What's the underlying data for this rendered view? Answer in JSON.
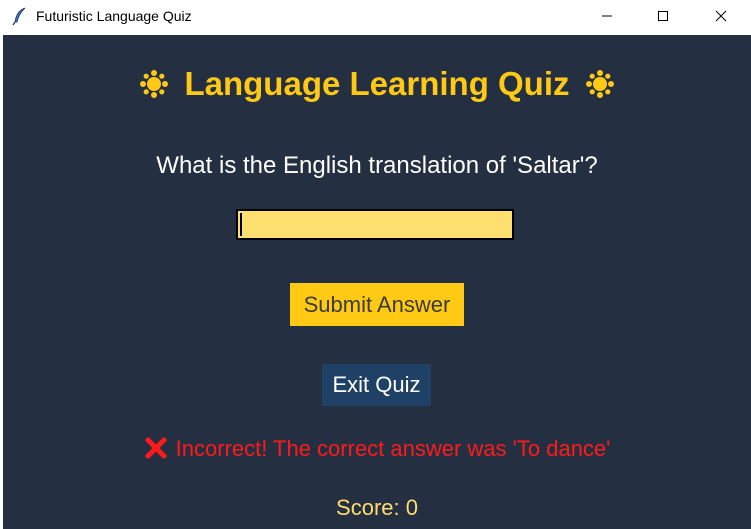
{
  "window": {
    "title": "Futuristic Language Quiz"
  },
  "quiz": {
    "heading_icon": "sun-icon",
    "heading": "Language Learning Quiz",
    "question": "What is the English translation of 'Saltar'?",
    "answer_value": "",
    "submit_label": "Submit Answer",
    "exit_label": "Exit Quiz",
    "feedback_icon": "cross-mark-icon",
    "feedback": "Incorrect! The correct answer was 'To dance'",
    "score": "Score: 0"
  },
  "colors": {
    "background": "#243042",
    "accent": "#ffc914",
    "input_bg": "#ffdf6f",
    "exit_button": "#1f4166",
    "error": "#ff1a1a",
    "score_text": "#ffdc6e"
  }
}
